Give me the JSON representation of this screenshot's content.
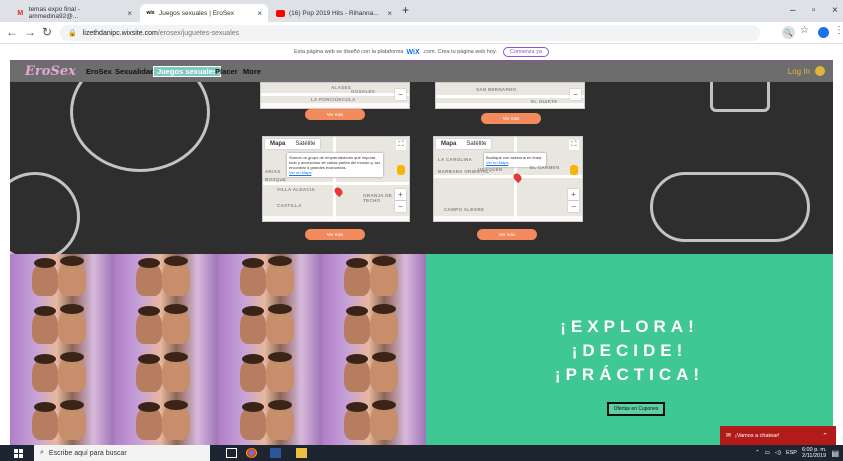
{
  "browser": {
    "tabs": [
      {
        "icon": "gmail-icon",
        "title": "temas expo final - ammedina92@..."
      },
      {
        "icon": "wix-icon",
        "title": "Juegos sexuales | EroSex"
      },
      {
        "icon": "youtube-icon",
        "title": "(16) Pop 2019 Hits - Rihanna..."
      }
    ],
    "new_tab": "+",
    "address": {
      "host": "lizethdanipc.wixsite.com",
      "path": "/erosex/juguetes-sexuales"
    }
  },
  "wix_banner": {
    "text": "Esta página web se diseñó con la plataforma",
    "brand": "WiX",
    "text2": ".com. Crea tu página web hoy.",
    "button": "Comienza ya"
  },
  "site": {
    "logo": "EroSex",
    "menu": [
      "EroSex",
      "Sexualidad",
      "Juegos sexuales",
      "Placer",
      "More"
    ],
    "active_menu": "Juegos sexuales",
    "header_right": "Log In"
  },
  "maps": {
    "top_left": {
      "streets": [
        "ALASES",
        "LA PORCIÚNCULA",
        "GOSALES"
      ]
    },
    "top_right": {
      "streets": [
        "SAN BERNARDO",
        "EL QUIETE"
      ]
    },
    "mid_left": {
      "tab_map": "Mapa",
      "tab_sat": "Satélite",
      "info": "Somos un grupo de emprendedores que importa todo y accesorios de varias partes del mundo y, así, encontrar a grandes economías.",
      "info_link": "Ver en Maps",
      "streets": [
        "ARIAS",
        "BOSQUE",
        "VILLA ALDACIA",
        "CASTILLA",
        "GRANJA DE TECHO"
      ]
    },
    "mid_right": {
      "tab_map": "Mapa",
      "tab_sat": "Satélite",
      "info": "Boutique con asesoría en línea",
      "info_link": "Ver en Maps",
      "streets": [
        "LA CAROLINA",
        "BARBARA ORIENTAL",
        "USAQUÉN",
        "EL CARMEN",
        "CAMPO ALEGRE"
      ]
    },
    "ver_mas": "Ver más"
  },
  "promo": {
    "line1": "¡EXPLORA!",
    "line2": "¡DECIDE!",
    "line3": "¡PRÁCTICA!",
    "button": "Ofertas en Cupones",
    "chat": "¡Vamos a chatear!"
  },
  "taskbar": {
    "search_placeholder": "Escribe aquí para buscar",
    "lang": "ESP",
    "time": "6:00 p. m.",
    "date": "2/11/2019"
  }
}
